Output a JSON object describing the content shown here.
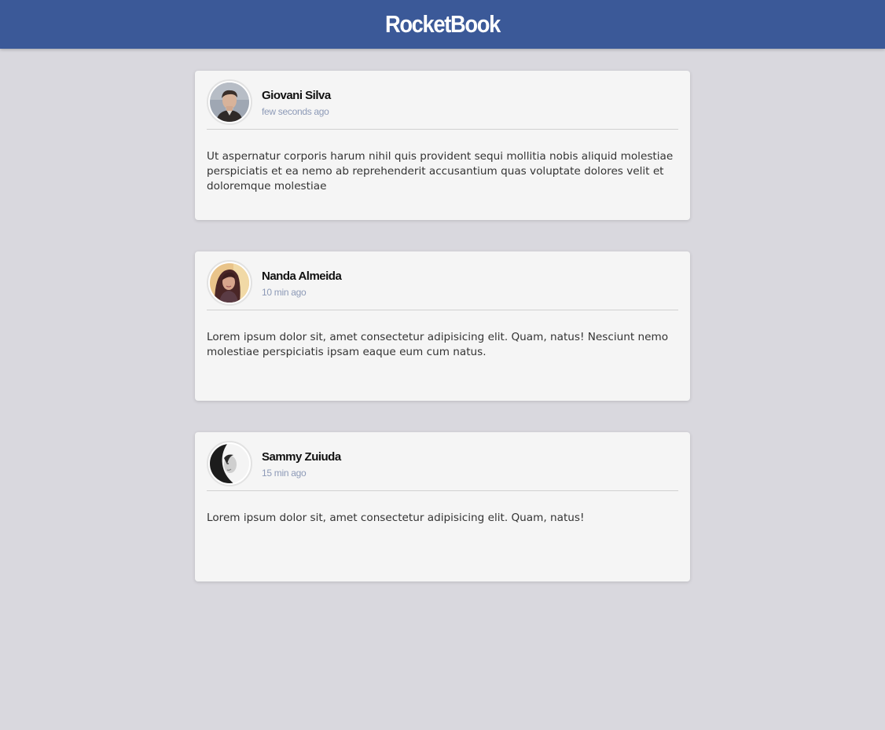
{
  "header": {
    "brand": "RocketBook",
    "color": "#3b5998"
  },
  "posts": [
    {
      "author": "Giovani Silva",
      "time": "few seconds ago",
      "content": "Ut aspernatur corporis harum nihil quis provident sequi mollitia nobis aliquid molestiae perspiciatis et ea nemo ab reprehenderit accusantium quas voluptate dolores velit et doloremque molestiae",
      "avatar_icon": "user-avatar-male"
    },
    {
      "author": "Nanda Almeida",
      "time": "10 min ago",
      "content": "Lorem ipsum dolor sit, amet consectetur adipisicing elit. Quam, natus! Nesciunt nemo molestiae perspiciatis ipsam eaque eum cum natus.",
      "avatar_icon": "user-avatar-female"
    },
    {
      "author": "Sammy Zuiuda",
      "time": "15 min ago",
      "content": "Lorem ipsum dolor sit, amet consectetur adipisicing elit. Quam, natus!",
      "avatar_icon": "user-avatar-female-bw"
    }
  ]
}
